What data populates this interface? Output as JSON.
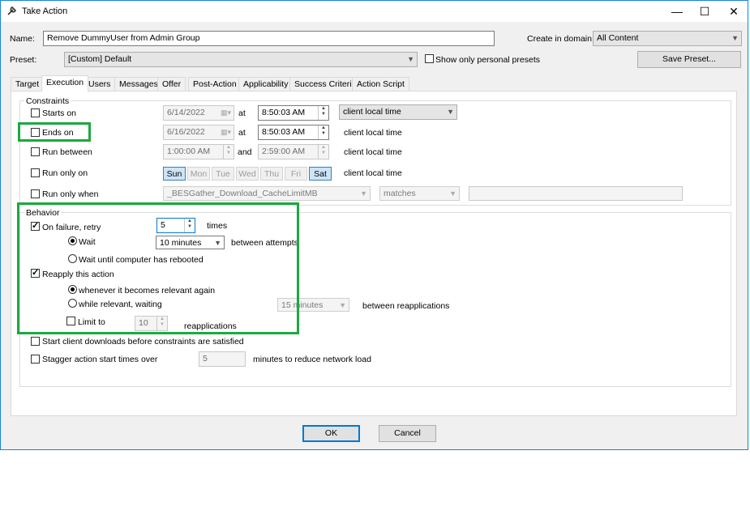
{
  "window": {
    "title": "Take Action",
    "controls": {
      "minimize": "—",
      "maximize": "☐",
      "close": "✕"
    }
  },
  "form": {
    "name_label": "Name:",
    "name_value": "Remove DummyUser from Admin Group",
    "create_in_domain_label": "Create in domain:",
    "create_in_domain_value": "All Content",
    "preset_label": "Preset:",
    "preset_value": "[Custom] Default",
    "show_personal_label": "Show only personal presets",
    "save_preset_label": "Save Preset..."
  },
  "tabs": [
    {
      "label": "Target"
    },
    {
      "label": "Execution"
    },
    {
      "label": "Users"
    },
    {
      "label": "Messages"
    },
    {
      "label": "Offer"
    },
    {
      "label": "Post-Action"
    },
    {
      "label": "Applicability"
    },
    {
      "label": "Success Criteria"
    },
    {
      "label": "Action Script"
    }
  ],
  "constraints": {
    "group_label": "Constraints",
    "starts_on": {
      "label": "Starts on",
      "date": "6/14/2022",
      "at": "at",
      "time": "8:50:03 AM",
      "tz": "client local time"
    },
    "ends_on": {
      "label": "Ends on",
      "date": "6/16/2022",
      "at": "at",
      "time": "8:50:03 AM",
      "tz": "client local time"
    },
    "run_between": {
      "label": "Run between",
      "from": "1:00:00 AM",
      "and": "and",
      "to": "2:59:00 AM",
      "tz": "client local time"
    },
    "run_only_on": {
      "label": "Run only on",
      "days": [
        "Sun",
        "Mon",
        "Tue",
        "Wed",
        "Thu",
        "Fri",
        "Sat"
      ],
      "selected": [
        "Sun",
        "Sat"
      ],
      "tz": "client local time"
    },
    "run_only_when": {
      "label": "Run only when",
      "property": "_BESGather_Download_CacheLimitMB",
      "operator": "matches",
      "value": ""
    }
  },
  "behavior": {
    "group_label": "Behavior",
    "on_failure": {
      "label": "On failure, retry",
      "count": "5",
      "times": "times"
    },
    "wait": {
      "label": "Wait",
      "value": "10 minutes",
      "suffix": "between attempts"
    },
    "wait_reboot": {
      "label": "Wait until computer has rebooted"
    },
    "reapply": {
      "label": "Reapply this action"
    },
    "whenever_relevant": {
      "label": "whenever it becomes relevant again"
    },
    "while_relevant": {
      "label": "while relevant, waiting",
      "value": "15 minutes",
      "suffix": "between reapplications"
    },
    "limit_to": {
      "label": "Limit to",
      "value": "10",
      "suffix": "reapplications"
    },
    "start_downloads": {
      "label": "Start client downloads before constraints are satisfied"
    },
    "stagger": {
      "label": "Stagger action start times over",
      "value": "5",
      "suffix": "minutes to reduce network load"
    }
  },
  "footer": {
    "ok_label": "OK",
    "cancel_label": "Cancel"
  },
  "colors": {
    "highlight": "#1da840",
    "accent": "#0078d7"
  }
}
